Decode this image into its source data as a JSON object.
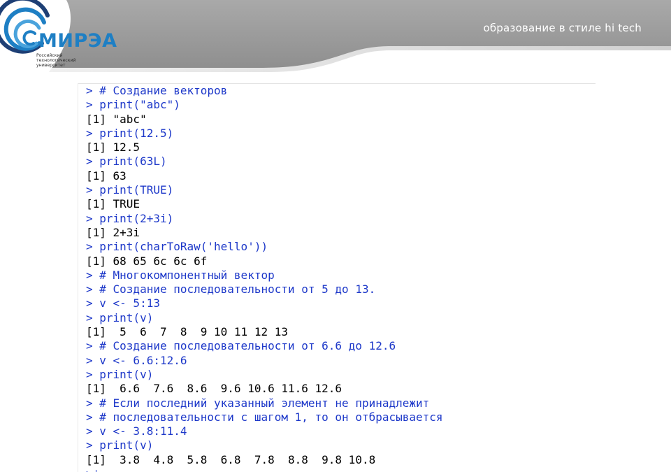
{
  "header": {
    "tagline": "образование в стиле hi tech",
    "logo": {
      "name": "МИРЭА",
      "subtitle_lines": [
        "Российский",
        "технологический",
        "университет"
      ]
    }
  },
  "console": {
    "lines": [
      {
        "type": "cmd",
        "text": "> # Создание векторов"
      },
      {
        "type": "cmd",
        "text": "> print(\"abc\")"
      },
      {
        "type": "out",
        "text": "[1] \"abc\""
      },
      {
        "type": "cmd",
        "text": "> print(12.5)"
      },
      {
        "type": "out",
        "text": "[1] 12.5"
      },
      {
        "type": "cmd",
        "text": "> print(63L)"
      },
      {
        "type": "out",
        "text": "[1] 63"
      },
      {
        "type": "cmd",
        "text": "> print(TRUE)"
      },
      {
        "type": "out",
        "text": "[1] TRUE"
      },
      {
        "type": "cmd",
        "text": "> print(2+3i)"
      },
      {
        "type": "out",
        "text": "[1] 2+3i"
      },
      {
        "type": "cmd",
        "text": "> print(charToRaw('hello'))"
      },
      {
        "type": "out",
        "text": "[1] 68 65 6c 6c 6f"
      },
      {
        "type": "cmd",
        "text": "> # Многокомпонентный вектор"
      },
      {
        "type": "cmd",
        "text": "> # Создание последовательности от 5 до 13."
      },
      {
        "type": "cmd",
        "text": "> v <- 5:13"
      },
      {
        "type": "cmd",
        "text": "> print(v)"
      },
      {
        "type": "out",
        "text": "[1]  5  6  7  8  9 10 11 12 13"
      },
      {
        "type": "cmd",
        "text": "> # Создание последовательности от 6.6 до 12.6"
      },
      {
        "type": "cmd",
        "text": "> v <- 6.6:12.6"
      },
      {
        "type": "cmd",
        "text": "> print(v)"
      },
      {
        "type": "out",
        "text": "[1]  6.6  7.6  8.6  9.6 10.6 11.6 12.6"
      },
      {
        "type": "cmd",
        "text": "> # Если последний указанный элемент не принадлежит"
      },
      {
        "type": "cmd",
        "text": "> # последовательности с шагом 1, то он отбрасывается"
      },
      {
        "type": "cmd",
        "text": "> v <- 3.8:11.4"
      },
      {
        "type": "cmd",
        "text": "> print(v)"
      },
      {
        "type": "out",
        "text": "[1]  3.8  4.8  5.8  6.8  7.8  8.8  9.8 10.8"
      }
    ],
    "prompt": ">"
  }
}
